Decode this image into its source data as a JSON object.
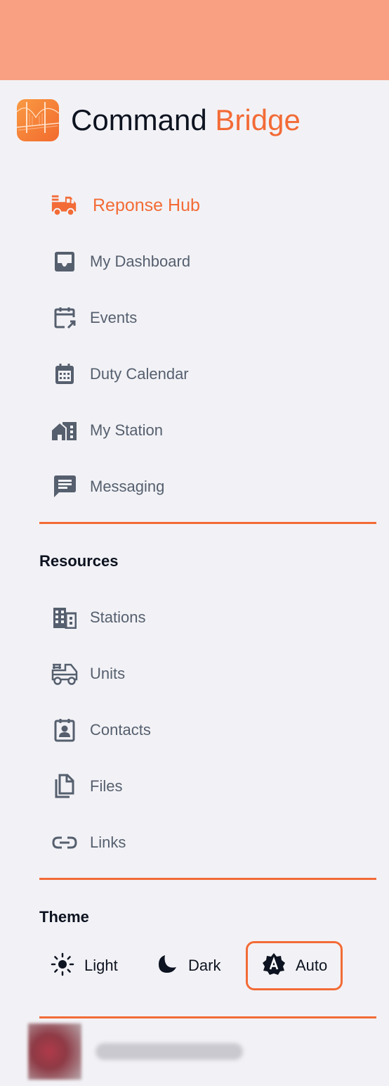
{
  "app": {
    "title_primary": "Command",
    "title_accent": "Bridge",
    "accent_color": "#f36b36",
    "header_color": "#f9a083"
  },
  "nav": {
    "main": [
      {
        "label": "Reponse Hub",
        "icon": "fire-truck-icon",
        "active": true
      },
      {
        "label": "My Dashboard",
        "icon": "inbox-icon"
      },
      {
        "label": "Events",
        "icon": "calendar-arrow-icon"
      },
      {
        "label": "Duty Calendar",
        "icon": "calendar-grid-icon"
      },
      {
        "label": "My Station",
        "icon": "station-house-icon"
      },
      {
        "label": "Messaging",
        "icon": "chat-icon"
      }
    ],
    "resources_title": "Resources",
    "resources": [
      {
        "label": "Stations",
        "icon": "building-icon"
      },
      {
        "label": "Units",
        "icon": "fire-truck-outline-icon"
      },
      {
        "label": "Contacts",
        "icon": "contact-card-icon"
      },
      {
        "label": "Files",
        "icon": "files-icon"
      },
      {
        "label": "Links",
        "icon": "link-icon"
      }
    ]
  },
  "theme": {
    "title": "Theme",
    "options": [
      {
        "label": "Light",
        "icon": "sun-icon"
      },
      {
        "label": "Dark",
        "icon": "moon-icon"
      },
      {
        "label": "Auto",
        "icon": "auto-theme-icon",
        "selected": true
      }
    ]
  }
}
